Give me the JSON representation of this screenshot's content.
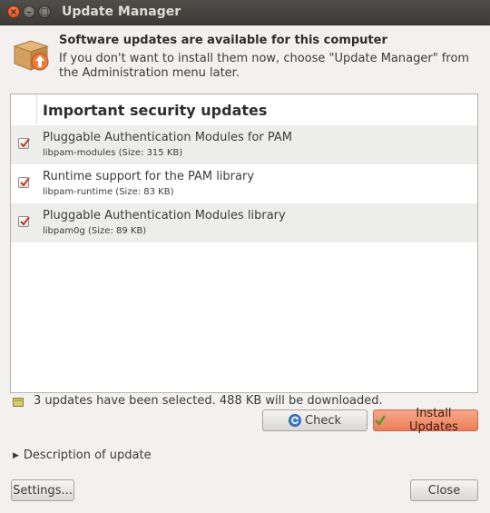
{
  "window": {
    "title": "Update Manager",
    "buttons": [
      "close-icon",
      "minimize-icon",
      "maximize-icon"
    ],
    "glyphs": {
      "close": "×",
      "minimize": "–",
      "maximize": "□"
    }
  },
  "header": {
    "icon": "package-update-icon",
    "title": "Software updates are available for this computer",
    "subtitle": "If you don't want to install them now, choose \"Update Manager\" from the Administration menu later."
  },
  "list": {
    "section_title": "Important security updates",
    "items": [
      {
        "name": "Pluggable Authentication Modules for PAM",
        "package": "libpam-modules (Size: 315 KB)",
        "checked": true
      },
      {
        "name": "Runtime support for the PAM library",
        "package": "libpam-runtime (Size: 83 KB)",
        "checked": true
      },
      {
        "name": "Pluggable Authentication Modules library",
        "package": "libpam0g (Size: 89 KB)",
        "checked": true
      }
    ]
  },
  "status": {
    "icon": "download-icon",
    "text": "3 updates have been selected. 488 KB will be downloaded."
  },
  "buttons": {
    "check": "Check",
    "install": "Install Updates",
    "settings": "Settings...",
    "close": "Close"
  },
  "expander": {
    "label": "Description of update",
    "expanded": false
  },
  "colors": {
    "titlebar": "#3c3b37",
    "accent": "#dd4814",
    "install_button": "#ec7e58",
    "checkbox_tick": "#c0392b"
  }
}
